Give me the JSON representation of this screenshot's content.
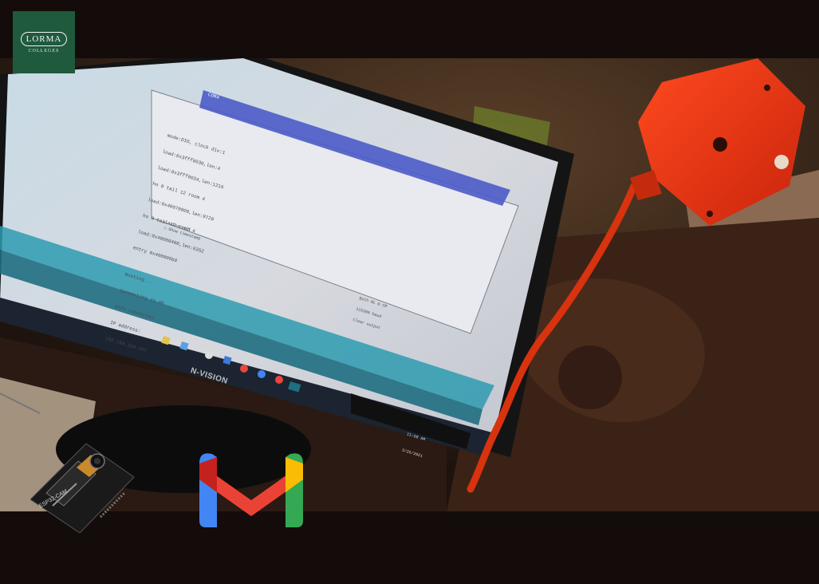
{
  "logo": {
    "name": "LORMA",
    "sub": "COLLEGES"
  },
  "monitor": {
    "brand": "N-VISION"
  },
  "serial_monitor": {
    "title": "COM4",
    "lines": [
      "mode:DIO, clock div:1",
      "load:0x3fff0030,len:4",
      "load:0x3fff0034,len:1216",
      "ho 0 tail 12 room 4",
      "load:0x40078000,len:9720",
      "ho 0 tail 12 room 4",
      "load:0x40080400,len:6352",
      "entry 0x400806b8",
      "",
      "Booting...",
      "Connecting to AP",
      "WiFi connected.",
      "IP address:",
      "192.168.254.157"
    ],
    "autoscroll_label": "Autoscroll",
    "timestamp_label": "Show timestamp",
    "line_ending": "Both NL & CR",
    "baud": "115200 baud",
    "clear_label": "Clear output"
  },
  "taskbar": {
    "time": "11:58 AM",
    "date": "3/25/2021"
  },
  "board": {
    "label": "ESP32-CAM"
  },
  "colors": {
    "logo_bg": "#1f5a3d",
    "gmail_blue": "#4285f4",
    "gmail_red": "#ea4335",
    "gmail_yellow": "#fbbc04",
    "gmail_green": "#34a853"
  }
}
